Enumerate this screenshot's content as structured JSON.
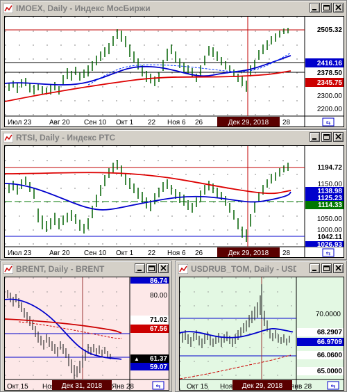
{
  "windows": {
    "imoex": {
      "title": "IMOEX, Daily - Индекс МосБиржи",
      "axis_labels": [
        "2300.00",
        "2200.00"
      ],
      "price_tags": [
        "2505.32",
        "2416.16",
        "2378.50",
        "2345.75"
      ],
      "date_labels": [
        "Июл 23",
        "Авг 20",
        "Сен 10",
        "Окт 1",
        "22",
        "Ноя 6",
        "26",
        "28"
      ],
      "crosshair_date": "Дек 29, 2018",
      "colors": {
        "price_line": "#c00000",
        "ma_fast": "#0000cc",
        "ma_slow": "#dd0000",
        "bg": "#ffffff"
      }
    },
    "rtsi": {
      "title": "RTSI, Daily - Индекс РТС",
      "axis_labels": [
        "1150.00",
        "1050.00",
        "1000.00"
      ],
      "price_tags": [
        "1194.72",
        "1138.98",
        "1125.23",
        "1114.33",
        "1042.11",
        "1026.93"
      ],
      "date_labels": [
        "Июл 23",
        "Авг 20",
        "Сен 10",
        "Окт 1",
        "22",
        "Ноя 6",
        "26",
        "28"
      ],
      "crosshair_date": "Дек 29, 2018",
      "colors": {
        "bg": "#ffffff"
      }
    },
    "brent": {
      "title": "BRENT, Daily - BRENT",
      "axis_labels": [
        "80.00"
      ],
      "price_tags": [
        "86.74",
        "71.02",
        "67.56",
        "61.37",
        "59.07"
      ],
      "date_labels": [
        "Окт 15",
        "Ноя",
        "Янв 28"
      ],
      "crosshair_date": "Дек 31, 2018",
      "colors": {
        "bg": "#fde8e8"
      }
    },
    "usdrub": {
      "title": "USDRUB_TOM, Daily - USDR...",
      "axis_labels": [
        "70.0000"
      ],
      "price_tags": [
        "68.2907",
        "66.9709",
        "66.0600",
        "65.0000"
      ],
      "date_labels": [
        "Окт 15",
        "Ноя",
        "янв 28"
      ],
      "crosshair_date": "Дек 29, 2018",
      "colors": {
        "bg": "#e3f8e3"
      }
    }
  }
}
